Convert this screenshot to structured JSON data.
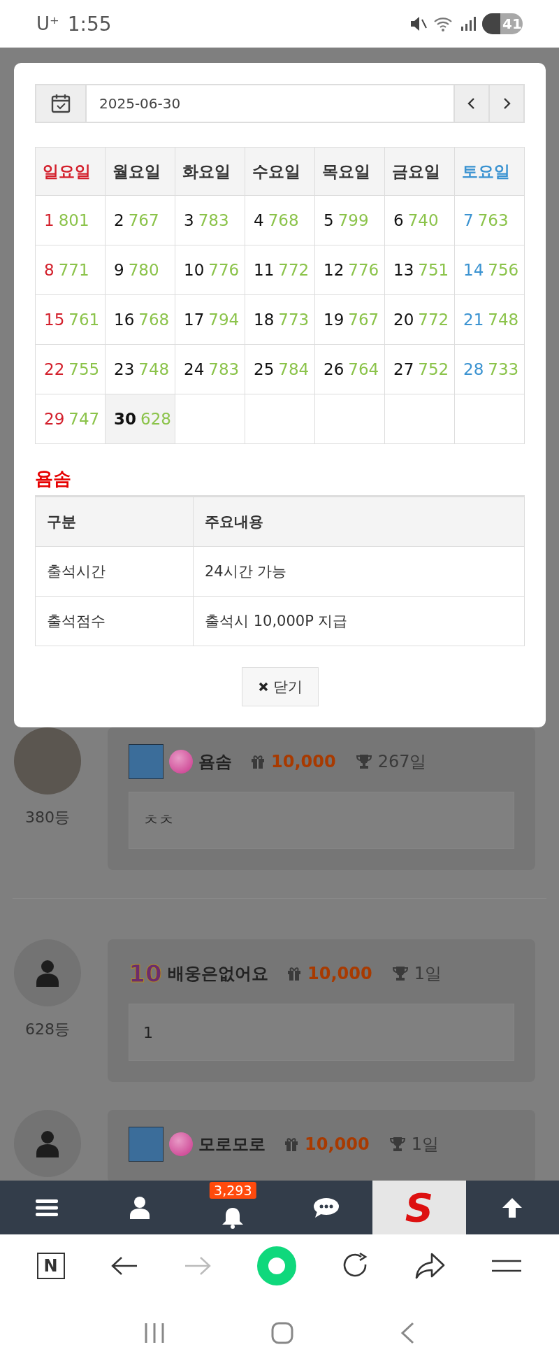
{
  "status_bar": {
    "carrier": "U⁺",
    "time": "1:55",
    "battery": "41"
  },
  "modal": {
    "date_field": {
      "value": "2025-06-30"
    },
    "calendar": {
      "weekdays": [
        "일요일",
        "월요일",
        "화요일",
        "수요일",
        "목요일",
        "금요일",
        "토요일"
      ],
      "weeks": [
        [
          {
            "day": "1",
            "count": "801",
            "selected": false
          },
          {
            "day": "2",
            "count": "767",
            "selected": false
          },
          {
            "day": "3",
            "count": "783",
            "selected": false
          },
          {
            "day": "4",
            "count": "768",
            "selected": false
          },
          {
            "day": "5",
            "count": "799",
            "selected": false
          },
          {
            "day": "6",
            "count": "740",
            "selected": false
          },
          {
            "day": "7",
            "count": "763",
            "selected": false
          }
        ],
        [
          {
            "day": "8",
            "count": "771",
            "selected": false
          },
          {
            "day": "9",
            "count": "780",
            "selected": false
          },
          {
            "day": "10",
            "count": "776",
            "selected": false
          },
          {
            "day": "11",
            "count": "772",
            "selected": false
          },
          {
            "day": "12",
            "count": "776",
            "selected": false
          },
          {
            "day": "13",
            "count": "751",
            "selected": false
          },
          {
            "day": "14",
            "count": "756",
            "selected": false
          }
        ],
        [
          {
            "day": "15",
            "count": "761",
            "selected": false
          },
          {
            "day": "16",
            "count": "768",
            "selected": false
          },
          {
            "day": "17",
            "count": "794",
            "selected": false
          },
          {
            "day": "18",
            "count": "773",
            "selected": false
          },
          {
            "day": "19",
            "count": "767",
            "selected": false
          },
          {
            "day": "20",
            "count": "772",
            "selected": false
          },
          {
            "day": "21",
            "count": "748",
            "selected": false
          }
        ],
        [
          {
            "day": "22",
            "count": "755",
            "selected": false
          },
          {
            "day": "23",
            "count": "748",
            "selected": false
          },
          {
            "day": "24",
            "count": "783",
            "selected": false
          },
          {
            "day": "25",
            "count": "784",
            "selected": false
          },
          {
            "day": "26",
            "count": "764",
            "selected": false
          },
          {
            "day": "27",
            "count": "752",
            "selected": false
          },
          {
            "day": "28",
            "count": "733",
            "selected": false
          }
        ],
        [
          {
            "day": "29",
            "count": "747",
            "selected": false
          },
          {
            "day": "30",
            "count": "628",
            "selected": true
          }
        ]
      ]
    },
    "info_title": "욤솜",
    "info_table": {
      "columns": [
        "구분",
        "주요내용"
      ],
      "rows": [
        [
          "출석시간",
          "24시간 가능"
        ],
        [
          "출석점수",
          "출석시 10,000P 지급"
        ]
      ]
    },
    "close_button": "닫기"
  },
  "comments": [
    {
      "avatar": {
        "kind": "photo"
      },
      "rank": "380등",
      "level_icon": {
        "kind": "picture"
      },
      "orb": true,
      "name": "욤솜",
      "points": "10,000",
      "days": "267일",
      "text": "ㅊㅊ"
    },
    {
      "avatar": {
        "kind": "default"
      },
      "rank": "628등",
      "level_icon": {
        "kind": "number",
        "label": "10"
      },
      "orb": false,
      "name": "배웅은없어요",
      "points": "10,000",
      "days": "1일",
      "text": "1"
    },
    {
      "avatar": {
        "kind": "default"
      },
      "level_icon": {
        "kind": "picture"
      },
      "orb": true,
      "name": "모로모로",
      "points": "10,000",
      "days": "1일"
    }
  ],
  "bottom_nav": {
    "notification_count": "3,293",
    "logo_text": "S"
  },
  "browser_toolbar": {
    "home_letter": "N"
  }
}
